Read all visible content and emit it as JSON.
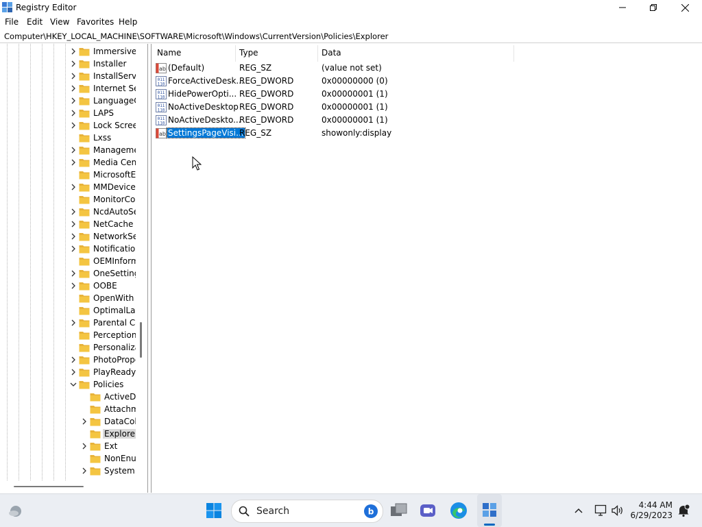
{
  "window": {
    "title": "Registry Editor"
  },
  "menu": [
    "File",
    "Edit",
    "View",
    "Favorites",
    "Help"
  ],
  "address": "Computer\\HKEY_LOCAL_MACHINE\\SOFTWARE\\Microsoft\\Windows\\CurrentVersion\\Policies\\Explorer",
  "tree": [
    {
      "label": "ImmersiveS",
      "level": 0,
      "expander": "collapsed"
    },
    {
      "label": "Installer",
      "level": 0,
      "expander": "collapsed"
    },
    {
      "label": "InstallServic",
      "level": 0,
      "expander": "collapsed"
    },
    {
      "label": "Internet Set",
      "level": 0,
      "expander": "collapsed"
    },
    {
      "label": "LanguageC",
      "level": 0,
      "expander": "collapsed"
    },
    {
      "label": "LAPS",
      "level": 0,
      "expander": "collapsed"
    },
    {
      "label": "Lock Screer",
      "level": 0,
      "expander": "collapsed"
    },
    {
      "label": "Lxss",
      "level": 0,
      "expander": "none"
    },
    {
      "label": "Manageme",
      "level": 0,
      "expander": "collapsed"
    },
    {
      "label": "Media Cent",
      "level": 0,
      "expander": "collapsed"
    },
    {
      "label": "MicrosoftEc",
      "level": 0,
      "expander": "none"
    },
    {
      "label": "MMDevices",
      "level": 0,
      "expander": "collapsed"
    },
    {
      "label": "MonitorCor",
      "level": 0,
      "expander": "none"
    },
    {
      "label": "NcdAutoSe",
      "level": 0,
      "expander": "collapsed"
    },
    {
      "label": "NetCache",
      "level": 0,
      "expander": "collapsed"
    },
    {
      "label": "NetworkSer",
      "level": 0,
      "expander": "collapsed"
    },
    {
      "label": "Notificatio",
      "level": 0,
      "expander": "collapsed"
    },
    {
      "label": "OEMInform",
      "level": 0,
      "expander": "none"
    },
    {
      "label": "OneSetting:",
      "level": 0,
      "expander": "collapsed"
    },
    {
      "label": "OOBE",
      "level": 0,
      "expander": "collapsed"
    },
    {
      "label": "OpenWith",
      "level": 0,
      "expander": "none"
    },
    {
      "label": "OptimalLay",
      "level": 0,
      "expander": "none"
    },
    {
      "label": "Parental Co",
      "level": 0,
      "expander": "collapsed"
    },
    {
      "label": "Perception",
      "level": 0,
      "expander": "none"
    },
    {
      "label": "Personalizat",
      "level": 0,
      "expander": "none"
    },
    {
      "label": "PhotoPrope",
      "level": 0,
      "expander": "collapsed"
    },
    {
      "label": "PlayReady",
      "level": 0,
      "expander": "collapsed"
    },
    {
      "label": "Policies",
      "level": 0,
      "expander": "expanded"
    },
    {
      "label": "ActiveDe",
      "level": 1,
      "expander": "none"
    },
    {
      "label": "Attachm",
      "level": 1,
      "expander": "none"
    },
    {
      "label": "DataColl",
      "level": 1,
      "expander": "collapsed"
    },
    {
      "label": "Explorer",
      "level": 1,
      "expander": "none",
      "selected": true
    },
    {
      "label": "Ext",
      "level": 1,
      "expander": "collapsed"
    },
    {
      "label": "NonEnur",
      "level": 1,
      "expander": "none"
    },
    {
      "label": "System",
      "level": 1,
      "expander": "collapsed"
    }
  ],
  "columns": {
    "name": "Name",
    "type": "Type",
    "data": "Data"
  },
  "values": [
    {
      "name": "(Default)",
      "type": "REG_SZ",
      "data": "(value not set)",
      "icon": "string-value-icon"
    },
    {
      "name": "ForceActiveDesk...",
      "type": "REG_DWORD",
      "data": "0x00000000 (0)",
      "icon": "binary-value-icon"
    },
    {
      "name": "HidePowerOpti...",
      "type": "REG_DWORD",
      "data": "0x00000001 (1)",
      "icon": "binary-value-icon"
    },
    {
      "name": "NoActiveDesktop",
      "type": "REG_DWORD",
      "data": "0x00000001 (1)",
      "icon": "binary-value-icon"
    },
    {
      "name": "NoActiveDeskto...",
      "type": "REG_DWORD",
      "data": "0x00000001 (1)",
      "icon": "binary-value-icon"
    },
    {
      "name": "SettingsPageVisi...",
      "type": "REG_SZ",
      "data": "showonly:display",
      "icon": "string-value-icon",
      "selected": true
    }
  ],
  "taskbar": {
    "search_label": "Search",
    "time": "4:44 AM",
    "date": "6/29/2023"
  },
  "colors": {
    "selection": "#0078d7",
    "folder": "#f4c542",
    "accent": "#0067c0"
  }
}
